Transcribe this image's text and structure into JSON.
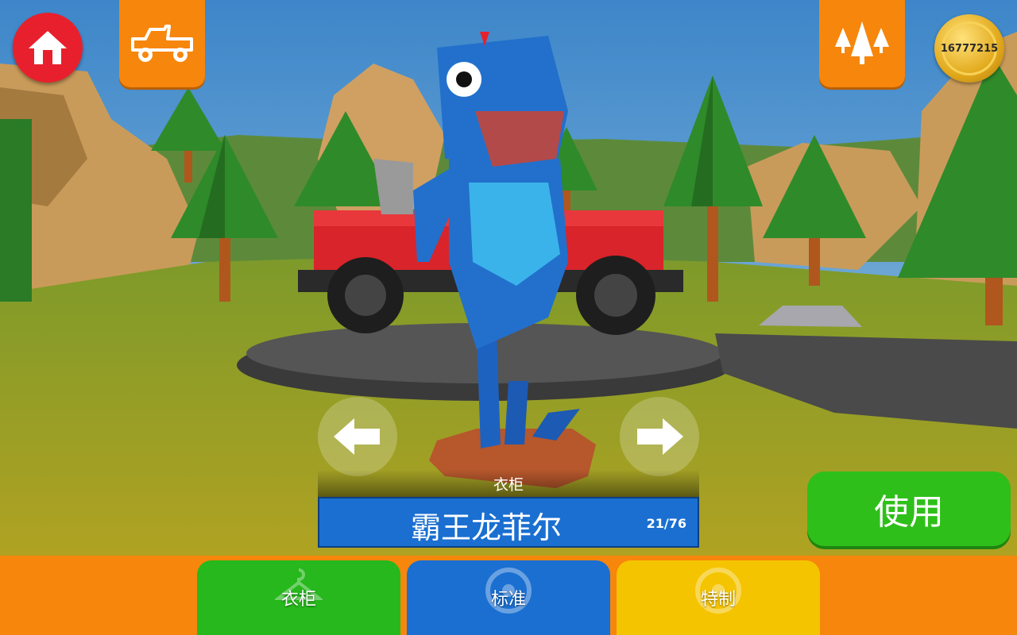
{
  "top_bar": {
    "coins": "16777215"
  },
  "character": {
    "wardrobe_caption": "衣柜",
    "name": "霸王龙菲尔",
    "index": "21/76"
  },
  "actions": {
    "use_label": "使用"
  },
  "tabs": [
    {
      "label": "衣柜",
      "color": "#26b81c",
      "icon": "hanger-icon"
    },
    {
      "label": "标准",
      "color": "#1a6fd1",
      "icon": "wheel-icon"
    },
    {
      "label": "特制",
      "color": "#f5c400",
      "icon": "wheel-icon"
    }
  ],
  "colors": {
    "accent": "#f7860c",
    "home": "#e8202d",
    "use": "#2fbf1a"
  }
}
